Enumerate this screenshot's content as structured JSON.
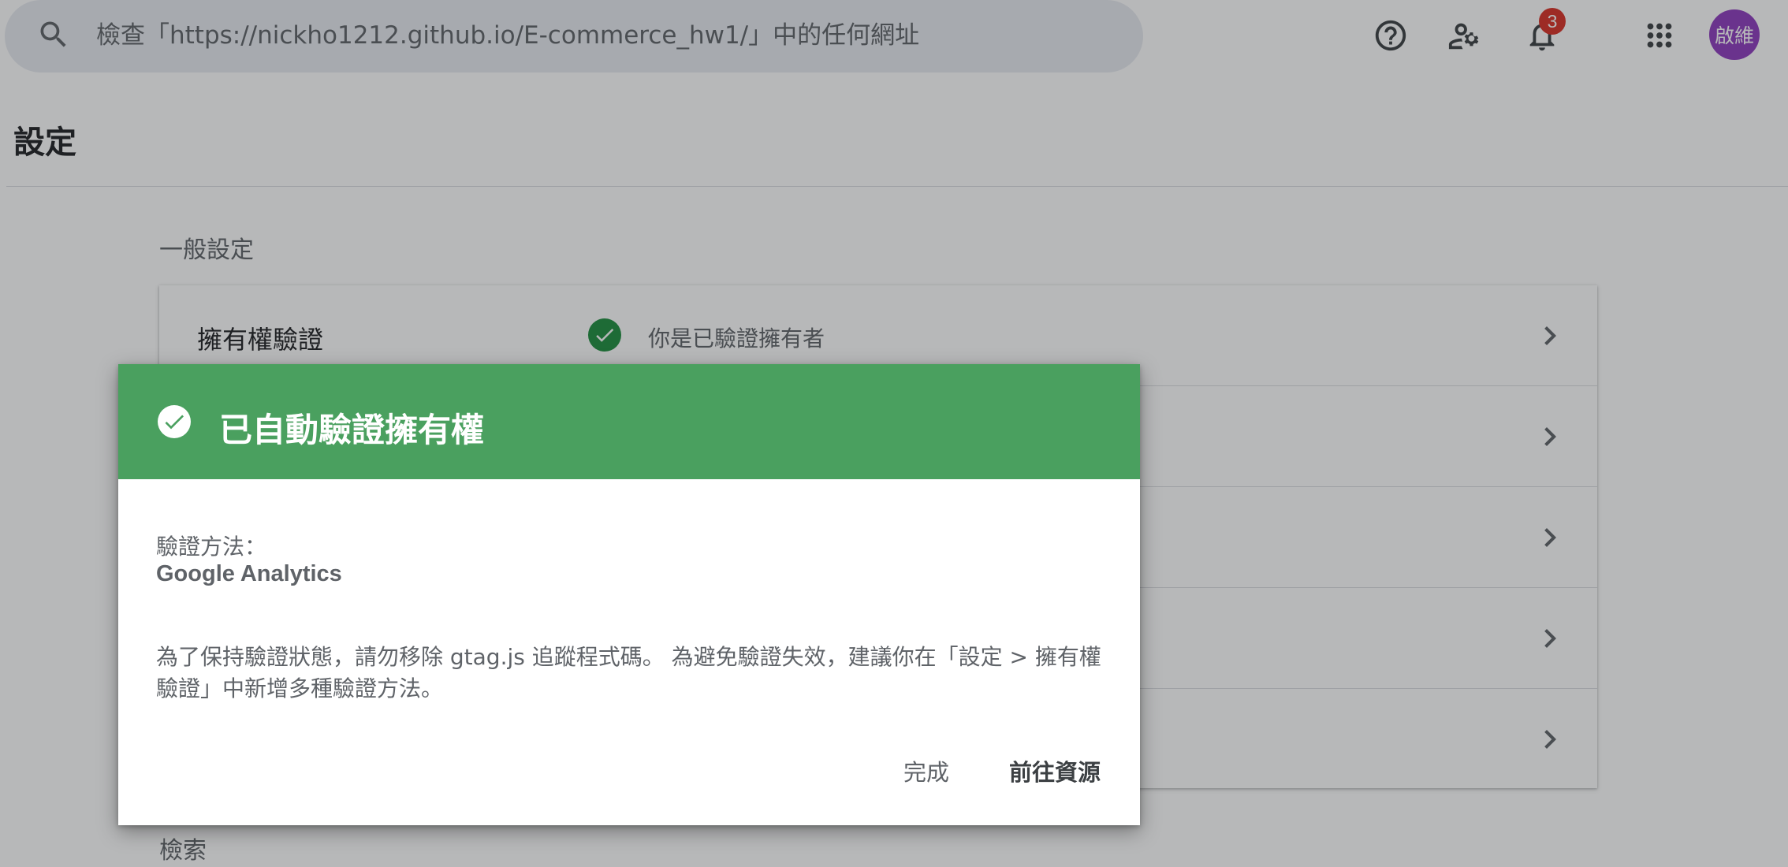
{
  "search": {
    "placeholder": "檢查「https://nickho1212.github.io/E-commerce_hw1/」中的任何網址"
  },
  "topbar": {
    "help_icon": "help-circle-icon",
    "users_settings_icon": "manage-users-icon",
    "notifications_icon": "bell-icon",
    "notifications_count": "3",
    "apps_icon": "apps-grid-icon",
    "avatar_text": "啟維",
    "avatar_color": "#8e3bbf"
  },
  "page": {
    "title": "設定",
    "general_heading": "一般設定",
    "next_heading": "檢索"
  },
  "settings_card": {
    "rows": [
      {
        "label": "擁有權驗證",
        "status": "你是已驗證擁有者",
        "status_color": "#1e8e3e"
      },
      {
        "label": "",
        "status": ""
      },
      {
        "label": "",
        "status": ""
      },
      {
        "label": "",
        "status": ""
      },
      {
        "label": "",
        "status": ""
      }
    ]
  },
  "dialog": {
    "header_color": "#4aa05f",
    "title": "已自動驗證擁有權",
    "method_label": "驗證方法：",
    "method_value": "Google Analytics",
    "body": "為了保持驗證狀態，請勿移除 gtag.js 追蹤程式碼。 為避免驗證失效，建議你在「設定 > 擁有權驗證」中新增多種驗證方法。",
    "done_label": "完成",
    "go_label": "前往資源"
  }
}
